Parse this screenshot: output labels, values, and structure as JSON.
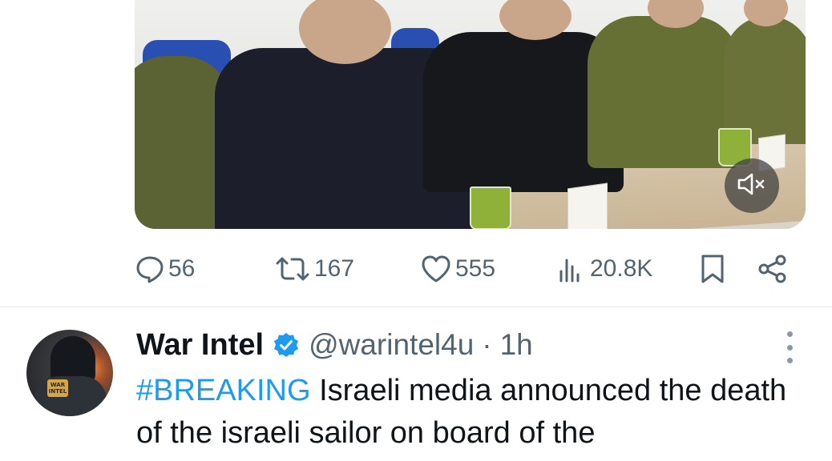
{
  "tweet_above": {
    "stats": {
      "replies": "56",
      "reposts": "167",
      "likes": "555",
      "views": "20.8K"
    }
  },
  "tweet": {
    "author_name": "War Intel",
    "handle": "@warintel4u",
    "separator": "·",
    "time": "1h",
    "hashtag": "#BREAKING",
    "body": "Israeli media announced the death of the israeli sailor on board of the",
    "avatar_patch_text": "WAR INTEL"
  },
  "colors": {
    "accent": "#1d9bf0",
    "muted": "#536471",
    "text": "#0f1419"
  },
  "icons": {
    "reply": "reply-icon",
    "repost": "repost-icon",
    "like": "heart-icon",
    "views": "views-icon",
    "bookmark": "bookmark-icon",
    "share": "share-icon",
    "mute": "volume-muted-icon",
    "verified": "verified-badge-icon",
    "more": "more-vertical-icon"
  }
}
